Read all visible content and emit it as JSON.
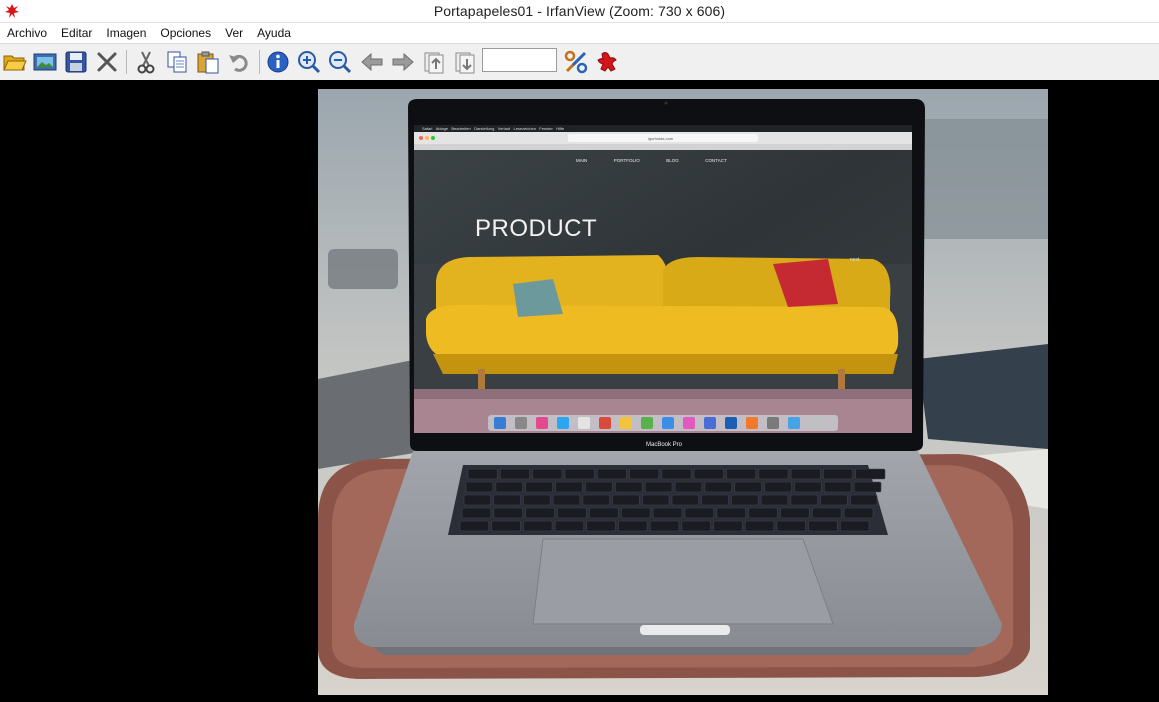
{
  "window": {
    "title": "Portapapeles01 - IrfanView (Zoom: 730 x 606)"
  },
  "menu": [
    "Archivo",
    "Editar",
    "Imagen",
    "Opciones",
    "Ver",
    "Ayuda"
  ],
  "toolbar": {
    "zoom_value": "",
    "buttons": [
      "open-folder-icon",
      "slideshow-icon",
      "save-icon",
      "delete-icon",
      "cut-icon",
      "copy-icon",
      "paste-icon",
      "undo-icon",
      "info-icon",
      "zoom-in-icon",
      "zoom-out-icon",
      "previous-icon",
      "next-icon",
      "first-page-icon",
      "last-page-icon",
      "settings-icon",
      "irfanview-icon"
    ]
  },
  "image": {
    "website": {
      "nav": [
        "MAIN",
        "PORTFOLIO",
        "BLOG",
        "CONTACT"
      ],
      "heading": "PRODUCT",
      "next_label": "next",
      "url": "igorholda.com"
    },
    "mac_menu": [
      "Safari",
      "Ablage",
      "Bearbeiten",
      "Darstellung",
      "Verlauf",
      "Lesezeichen",
      "Fenster",
      "Hilfe"
    ],
    "laptop_label": "MacBook Pro"
  }
}
